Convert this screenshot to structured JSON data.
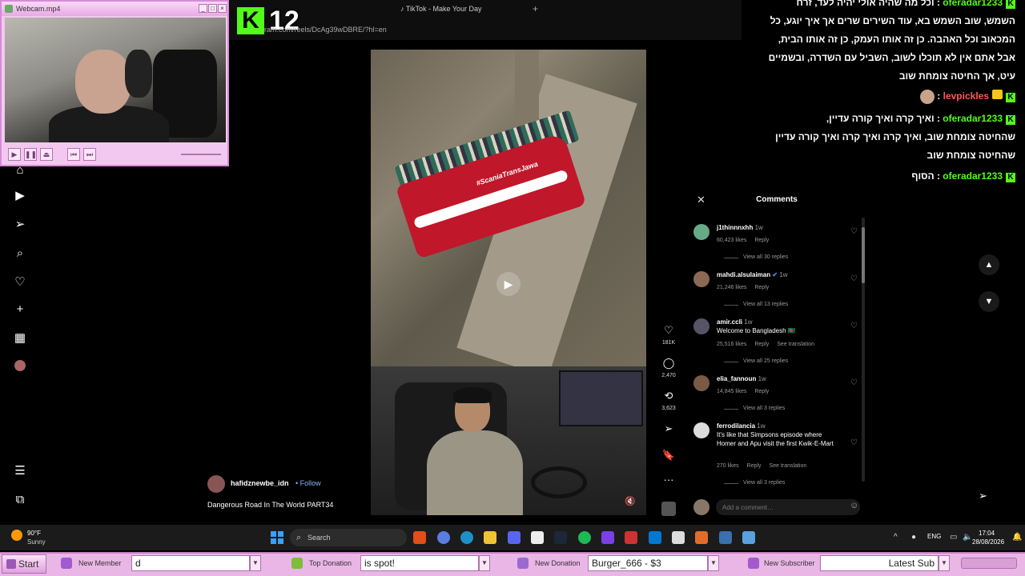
{
  "webcam": {
    "title": "Webcam.mp4"
  },
  "browser": {
    "tab_title": "TikTok - Make Your Day",
    "address": "ram.com/reels/DcAg39wDBRE/?hl=en"
  },
  "kick": {
    "count": "12"
  },
  "video": {
    "bus_text": "#ScaniaTransJawa",
    "creator": "hafidznewbe_idn",
    "follow": "Follow",
    "caption": "Dangerous Road In The World PART34"
  },
  "actions": {
    "likes": "181K",
    "comments": "2,470",
    "reposts": "3,623"
  },
  "chat": {
    "lines": [
      {
        "user": "oferadar1233",
        "text": "וכל מה שהיה אולי יהיה לעד, זרח"
      },
      {
        "user": "",
        "text": "השמש, שוב השמש בא, עוד השירים שרים אך איך יוגע, כל"
      },
      {
        "user": "",
        "text": "המכאוב וכל האהבה. כן זה אותו העמק, כן זה אותו הבית,"
      },
      {
        "user": "",
        "text": "אבל אתם אין לא תוכלו לשוב, השביל עם השדרה, ובשמיים"
      },
      {
        "user": "",
        "text": "עיט, אך החיטה צומחת שוב"
      },
      {
        "user": "levpickles",
        "text": ""
      },
      {
        "user": "oferadar1233",
        "text": "ואיך קרה ואיך קורה עדיין,"
      },
      {
        "user": "",
        "text": "שהחיטה צומחת שוב, ואיך קרה ואיך קרה ואיך קורה עדיין"
      },
      {
        "user": "",
        "text": "שהחיטה צומחת שוב"
      },
      {
        "user": "oferadar1233",
        "text": "הסוף"
      }
    ]
  },
  "comments": {
    "title": "Comments",
    "items": [
      {
        "user": "j1thinnnxhh",
        "time": "1w",
        "text": "",
        "likes": "60,423 likes",
        "reply": "Reply",
        "translate": "",
        "replies": "View all 30 replies"
      },
      {
        "user": "mahdi.alsulaiman",
        "time": "1w",
        "text": "",
        "likes": "21,246 likes",
        "reply": "Reply",
        "translate": "",
        "replies": "View all 13 replies"
      },
      {
        "user": "amir.ccli",
        "time": "1w",
        "text": "Welcome to Bangladesh 🇧🇩",
        "likes": "25,516 likes",
        "reply": "Reply",
        "translate": "See translation",
        "replies": "View all 25 replies"
      },
      {
        "user": "elia_fannoun",
        "time": "1w",
        "text": "",
        "likes": "14,845 likes",
        "reply": "Reply",
        "translate": "",
        "replies": "View all 3 replies"
      },
      {
        "user": "ferrodilancia",
        "time": "1w",
        "text": "It's like that Simpsons episode where Homer and Apu visit the first Kwik-E-Mart",
        "likes": "270 likes",
        "reply": "Reply",
        "translate": "See translation",
        "replies": "View all 3 replies"
      }
    ],
    "add_placeholder": "Add a comment…"
  },
  "taskbar": {
    "temp": "90°F",
    "condition": "Sunny",
    "search": "Search",
    "lang": "ENG",
    "time": "17:04",
    "date": "28/08/2026"
  },
  "alerts": {
    "start": "Start",
    "new_member_label": "New Member",
    "new_member_value": "d",
    "top_donation_label": "Top Donation",
    "top_donation_value": "is spot!",
    "new_donation_label": "New Donation",
    "new_donation_value": "Burger_666 - $3",
    "new_subscriber_label": "New Subscriber",
    "new_subscriber_value": "Latest Sub"
  }
}
